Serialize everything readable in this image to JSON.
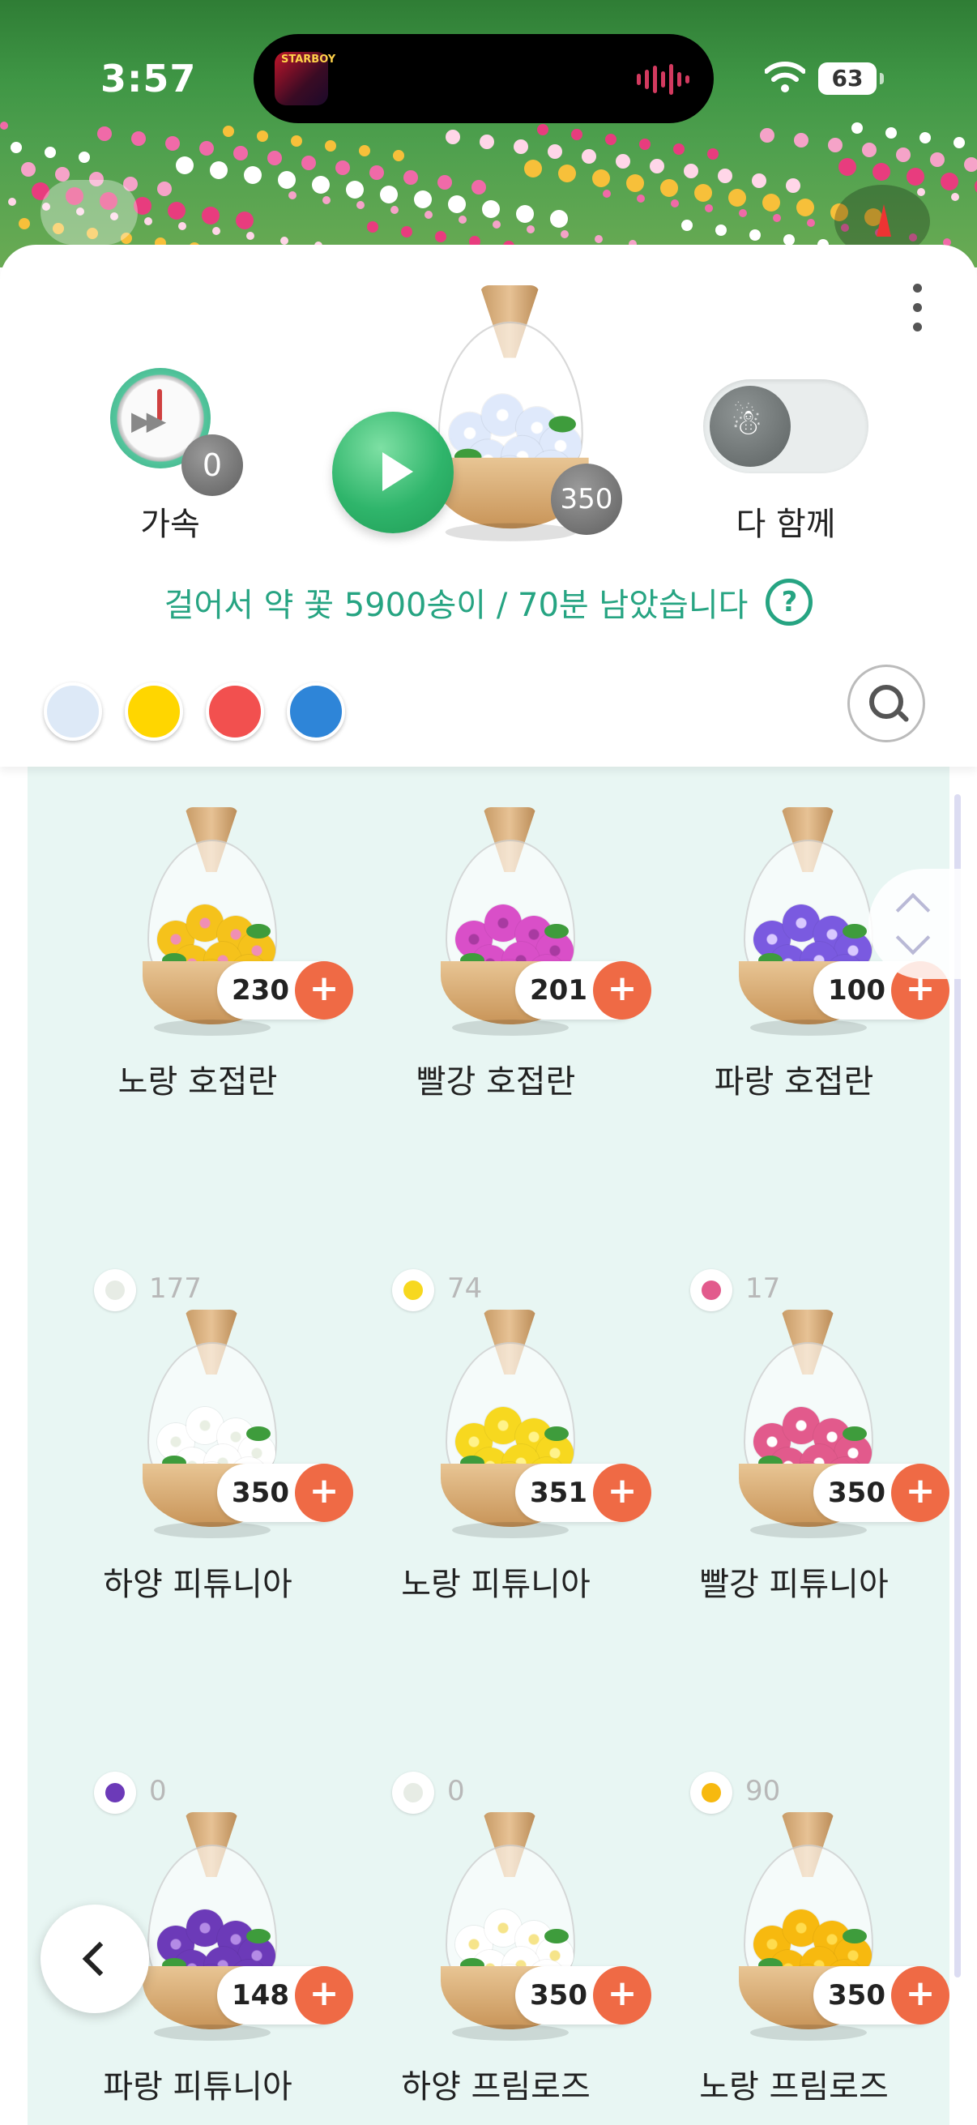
{
  "status": {
    "time": "3:57",
    "battery": "63",
    "album_text": "STARBOY"
  },
  "panel": {
    "speed_label": "가속",
    "speed_count": "0",
    "main_bottle_count": "350",
    "together_label": "다 함께",
    "info_text": "걸어서 약 꽃 5900송이 / 70분 남았습니다",
    "help_glyph": "?",
    "color_filters": [
      "#dde9f7",
      "#ffd600",
      "#f2504f",
      "#2e85d8"
    ]
  },
  "icons": {
    "more": "more-vertical-icon",
    "speed": "fast-forward-clock-icon",
    "play": "play-icon",
    "together": "walking-people-icon",
    "help": "question-circle-icon",
    "search": "search-icon",
    "back": "chevron-left-icon",
    "scroll": "chevron-up-down-icon",
    "add": "plus-icon"
  },
  "flowers": [
    {
      "name": "노랑 호접란",
      "stock": "230",
      "owned": "",
      "color": "#f5c21b",
      "accent": "#f08fb4"
    },
    {
      "name": "빨강 호접란",
      "stock": "201",
      "owned": "",
      "color": "#d94fc8",
      "accent": "#a83aa1"
    },
    {
      "name": "파랑 호접란",
      "stock": "100",
      "owned": "",
      "color": "#7a5ae0",
      "accent": "#d9c9ff"
    },
    {
      "name": "하양 피튜니아",
      "stock": "350",
      "owned": "177",
      "color": "#ffffff",
      "accent": "#e9efe3"
    },
    {
      "name": "노랑 피튜니아",
      "stock": "351",
      "owned": "74",
      "color": "#f7d81f",
      "accent": "#fff38a"
    },
    {
      "name": "빨강 피튜니아",
      "stock": "350",
      "owned": "17",
      "color": "#e25a8c",
      "accent": "#ffffff"
    },
    {
      "name": "파랑 피튜니아",
      "stock": "148",
      "owned": "0",
      "color": "#6c3ab8",
      "accent": "#b48be6"
    },
    {
      "name": "하양 프림로즈",
      "stock": "350",
      "owned": "0",
      "color": "#ffffff",
      "accent": "#f6e48a"
    },
    {
      "name": "노랑 프림로즈",
      "stock": "350",
      "owned": "90",
      "color": "#f7b90f",
      "accent": "#ffdc4d"
    }
  ],
  "add_label": "+"
}
